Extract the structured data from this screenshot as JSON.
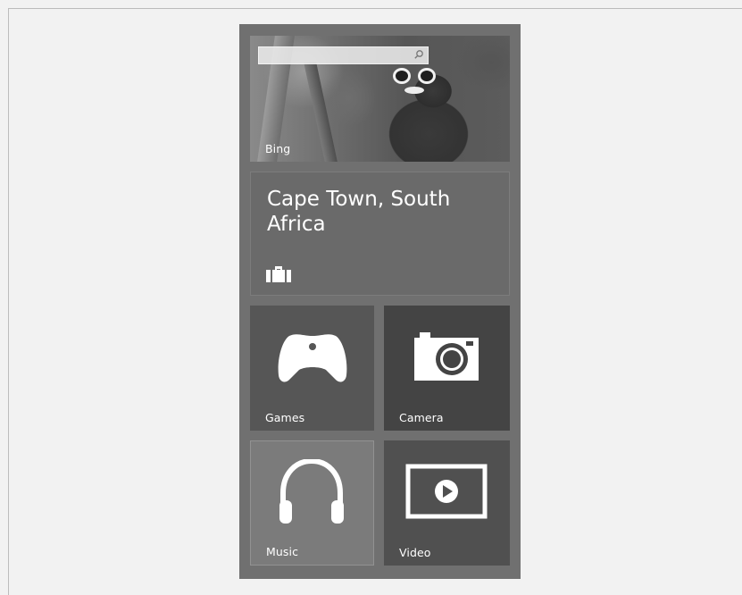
{
  "search": {
    "value": "",
    "icon": "search-icon"
  },
  "tiles": {
    "bing": {
      "label": "Bing"
    },
    "travel": {
      "title": "Cape Town, South Africa",
      "icon": "suitcase-icon"
    },
    "games": {
      "label": "Games",
      "icon": "game-controller-icon"
    },
    "camera": {
      "label": "Camera",
      "icon": "camera-icon"
    },
    "music": {
      "label": "Music",
      "icon": "headphones-icon"
    },
    "video": {
      "label": "Video",
      "icon": "video-play-icon"
    }
  },
  "colors": {
    "page_background": "#f2f2f2",
    "panel_background": "#707070",
    "tile_text": "#ffffff"
  }
}
